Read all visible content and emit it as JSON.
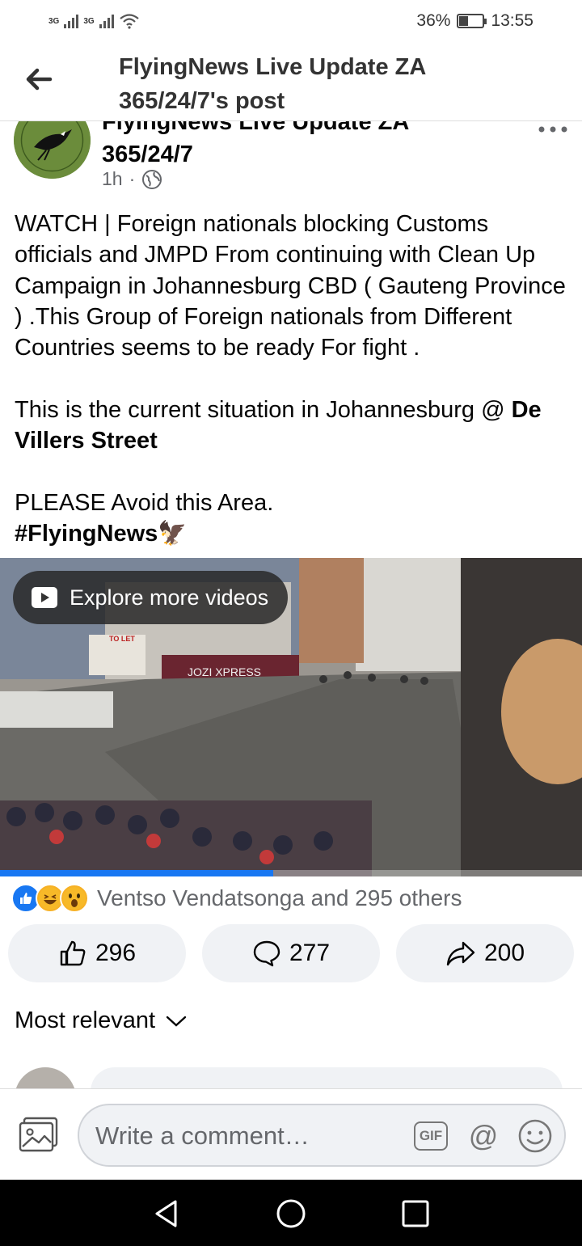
{
  "status_bar": {
    "signal1_label": "3G",
    "signal2_label": "3G",
    "battery_percent": "36%",
    "battery_level": 0.36,
    "time": "13:55"
  },
  "header": {
    "title": "FlyingNews Live Update ZA 365/24/7's post"
  },
  "post": {
    "author": "FlyingNews Live Update ZA 365/24/7",
    "time_ago": "1h",
    "separator": "·",
    "privacy_icon": "globe-icon",
    "paragraph1": "WATCH | Foreign nationals blocking Customs officials and JMPD From continuing with Clean Up Campaign in Johannesburg CBD ( Gauteng Province ) .This Group of Foreign nationals from Different Countries seems to be ready For fight .",
    "paragraph2_prefix": "This is the current situation in Johannesburg @ ",
    "paragraph2_bold": "De Villers Street",
    "paragraph3": "PLEASE Avoid this Area.",
    "hashtag": "#FlyingNews",
    "hashtag_emoji": "🦅"
  },
  "video": {
    "explore_label": "Explore more videos",
    "sign_to_let": "TO LET",
    "sign_store": "JOZI XPRESS",
    "progress": 0.47
  },
  "reactions": {
    "summary": "Ventso Vendatsonga and 295 others",
    "icons": [
      "like-icon",
      "haha-icon",
      "wow-icon"
    ]
  },
  "actions": {
    "like_count": "296",
    "comment_count": "277",
    "share_count": "200"
  },
  "comments": {
    "sort_label": "Most relevant"
  },
  "composer": {
    "placeholder": "Write a comment…",
    "gif_label": "GIF",
    "at_label": "@"
  },
  "colors": {
    "accent": "#1877f2",
    "secondary_text": "#65676b",
    "button_bg": "#f0f2f5"
  }
}
